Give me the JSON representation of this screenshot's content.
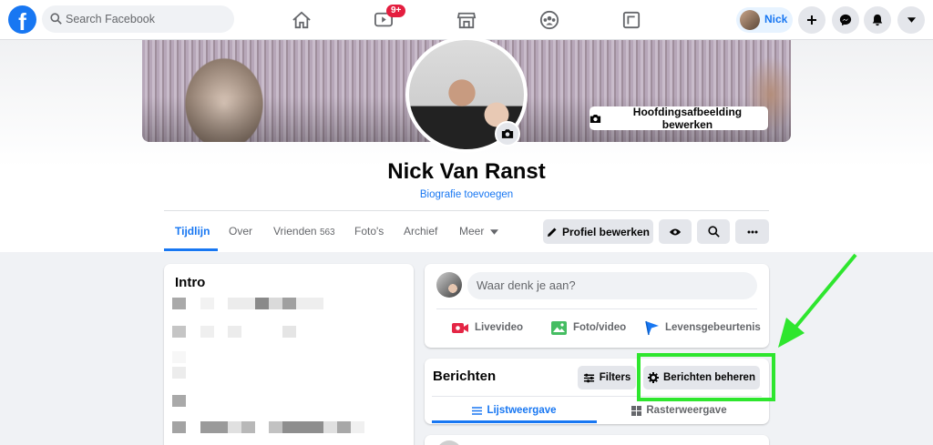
{
  "topbar": {
    "logo": "f",
    "search_placeholder": "Search Facebook",
    "watch_badge": "9+",
    "user_name": "Nick",
    "icons": [
      "search-icon",
      "home-icon",
      "watch-icon",
      "marketplace-icon",
      "groups-icon",
      "gaming-icon",
      "plus-icon",
      "messenger-icon",
      "notifications-icon",
      "caret-down-icon"
    ]
  },
  "profile": {
    "edit_cover_label": "Hoofdingsafbeelding bewerken",
    "name": "Nick Van Ranst",
    "bio_link": "Biografie toevoegen"
  },
  "tabs": {
    "timeline": "Tijdlijn",
    "about": "Over",
    "friends": "Vrienden",
    "friends_count": "563",
    "photos": "Foto's",
    "archive": "Archief",
    "more": "Meer"
  },
  "actions": {
    "edit_profile": "Profiel bewerken"
  },
  "intro": {
    "title": "Intro"
  },
  "composer": {
    "placeholder": "Waar denk je aan?",
    "live_video": "Livevideo",
    "photo_video": "Foto/video",
    "life_event": "Levensgebeurtenis"
  },
  "posts": {
    "title": "Berichten",
    "filters": "Filters",
    "manage_posts": "Berichten beheren",
    "list_view": "Lijstweergave",
    "grid_view": "Rasterweergave"
  },
  "colors": {
    "accent": "#1877f2",
    "highlight": "#2ee62e",
    "live_red": "#e42645",
    "photo_green": "#45bd62",
    "event_blue": "#1877f2"
  }
}
